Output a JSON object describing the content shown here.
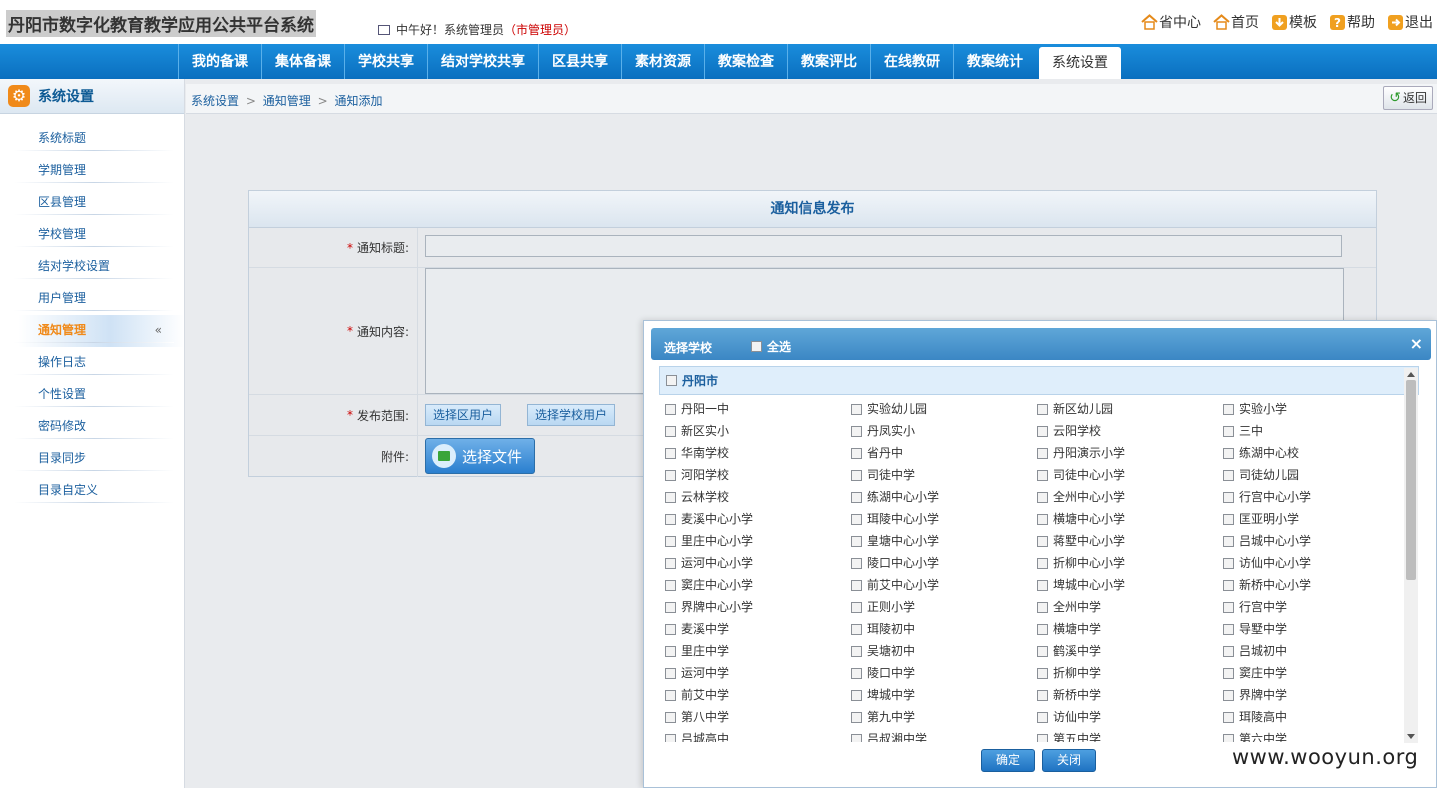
{
  "header": {
    "site_title": "丹阳市数字化教育教学应用公共平台系统",
    "greeting": "中午好！",
    "user": "系统管理员",
    "role": "（市管理员）",
    "links": [
      "省中心",
      "首页",
      "模板",
      "帮助",
      "退出"
    ]
  },
  "nav": {
    "items": [
      "我的备课",
      "集体备课",
      "学校共享",
      "结对学校共享",
      "区县共享",
      "素材资源",
      "教案检查",
      "教案评比",
      "在线教研",
      "教案统计",
      "系统设置"
    ],
    "active": "系统设置"
  },
  "sidebar": {
    "title": "系统设置",
    "items": [
      "系统标题",
      "学期管理",
      "区县管理",
      "学校管理",
      "结对学校设置",
      "用户管理",
      "通知管理",
      "操作日志",
      "个性设置",
      "密码修改",
      "目录同步",
      "目录自定义"
    ],
    "active": "通知管理",
    "collapse_glyph": "«"
  },
  "breadcrumb": {
    "items": [
      "系统设置",
      "通知管理",
      "通知添加"
    ],
    "separator": ">",
    "back_label": "返回"
  },
  "form": {
    "title": "通知信息发布",
    "required_mark": "*",
    "title_label": "通知标题:",
    "title_value": "",
    "content_label": "通知内容:",
    "content_value": "",
    "scope_label": "发布范围:",
    "scope_district_btn": "选择区用户",
    "scope_school_btn": "选择学校用户",
    "attachment_label": "附件:",
    "file_btn": "选择文件"
  },
  "dialog": {
    "title": "选择学校",
    "select_all": "全选",
    "close_glyph": "×",
    "city": "丹阳市",
    "schools": [
      "丹阳一中",
      "实验幼儿园",
      "新区幼儿园",
      "实验小学",
      "新区实小",
      "丹凤实小",
      "云阳学校",
      "三中",
      "华南学校",
      "省丹中",
      "丹阳演示小学",
      "练湖中心校",
      "河阳学校",
      "司徒中学",
      "司徒中心小学",
      "司徒幼儿园",
      "云林学校",
      "练湖中心小学",
      "全州中心小学",
      "行宫中心小学",
      "麦溪中心小学",
      "珥陵中心小学",
      "横塘中心小学",
      "匡亚明小学",
      "里庄中心小学",
      "皇塘中心小学",
      "蒋墅中心小学",
      "吕城中心小学",
      "运河中心小学",
      "陵口中心小学",
      "折柳中心小学",
      "访仙中心小学",
      "窦庄中心小学",
      "前艾中心小学",
      "埤城中心小学",
      "新桥中心小学",
      "界牌中心小学",
      "正则小学",
      "全州中学",
      "行宫中学",
      "麦溪中学",
      "珥陵初中",
      "横塘中学",
      "导墅中学",
      "里庄中学",
      "吴塘初中",
      "鹤溪中学",
      "吕城初中",
      "运河中学",
      "陵口中学",
      "折柳中学",
      "窦庄中学",
      "前艾中学",
      "埤城中学",
      "新桥中学",
      "界牌中学",
      "第八中学",
      "第九中学",
      "访仙中学",
      "珥陵高中",
      "吕城高中",
      "吕叔湘中学",
      "第五中学",
      "第六中学"
    ],
    "confirm_label": "确定",
    "close_label": "关闭"
  },
  "watermark": "www.wooyun.org"
}
